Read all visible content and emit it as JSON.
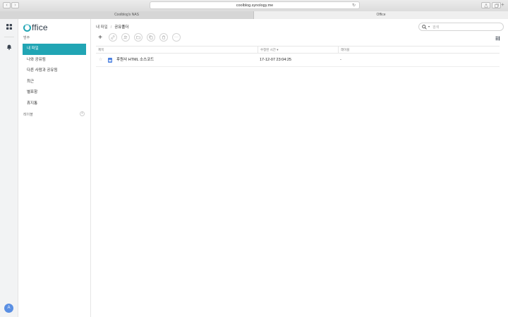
{
  "browser": {
    "url": "coolblog.synology.me",
    "tabs": [
      {
        "label": "Coolblog's NAS"
      },
      {
        "label": "Office"
      }
    ]
  },
  "rail": {
    "avatar_letter": "A"
  },
  "sidebar": {
    "logo_text": "ffice",
    "category_label": "범주",
    "items": [
      {
        "label": "내 파일",
        "active": true
      },
      {
        "label": "나와 공유됨"
      },
      {
        "label": "다른 사람과 공유됨"
      },
      {
        "label": "최근"
      },
      {
        "label": "별표함"
      },
      {
        "label": "휴지통"
      }
    ],
    "labels_heading": "레이블",
    "add_label_symbol": "+"
  },
  "main": {
    "breadcrumb": {
      "root": "내 파일",
      "separator": "/",
      "current": "공유폴더"
    },
    "search": {
      "placeholder": "검색"
    },
    "toolbar": {
      "new_symbol": "+",
      "more_symbol": "···"
    },
    "table": {
      "columns": [
        {
          "label": "제목"
        },
        {
          "label": "수정된 시간 ▾"
        },
        {
          "label": "레이블"
        }
      ],
      "rows": [
        {
          "title": "후원사 HTML 소스코드",
          "modified": "17-12-07 23:04:25",
          "label": "-"
        }
      ]
    }
  },
  "colors": {
    "accent": "#21a5b4",
    "doc_icon": "#4a7fe0",
    "avatar": "#5a8fe3"
  }
}
